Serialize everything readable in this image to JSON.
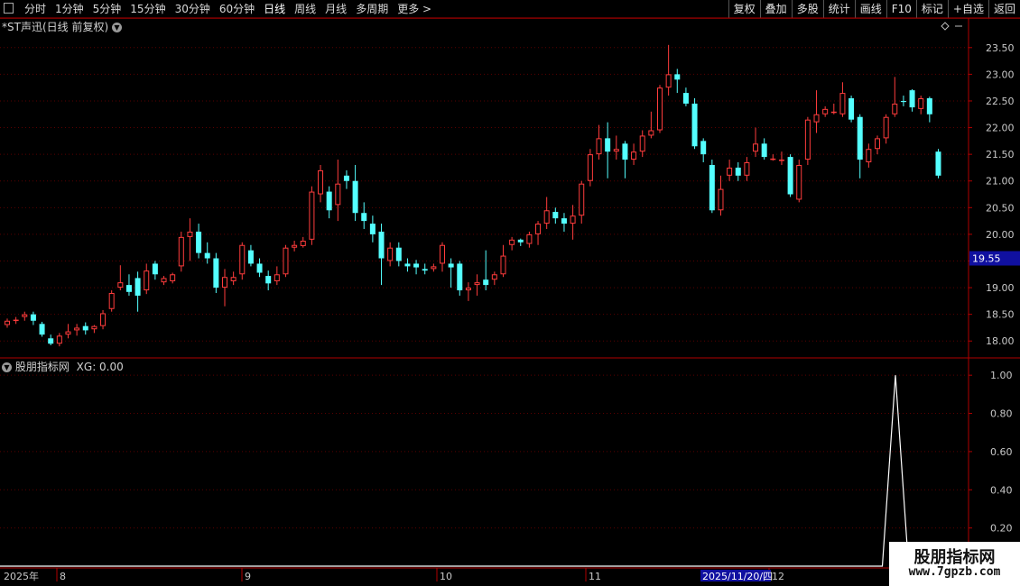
{
  "toolbar": {
    "periods": [
      "分时",
      "1分钟",
      "5分钟",
      "15分钟",
      "30分钟",
      "60分钟",
      "日线",
      "周线",
      "月线",
      "多周期",
      "更多 >"
    ],
    "active_period": "日线",
    "tools": [
      "复权",
      "叠加",
      "多股",
      "统计",
      "画线",
      "F10",
      "标记",
      "+自选",
      "返回"
    ]
  },
  "main_panel": {
    "title": "*ST声迅(日线 前复权)",
    "current_price_tag": "19.55"
  },
  "indicator_panel": {
    "title": "股朋指标网",
    "value_label": "XG: 0.00"
  },
  "x_axis": {
    "year_label": "2025年",
    "month_labels": [
      "8",
      "9",
      "10",
      "11",
      "12"
    ],
    "cursor_date": "2025/11/20/四"
  },
  "logo": {
    "name": "股朋指标网",
    "url": "www.7gpzb.com"
  },
  "colors": {
    "up": "#ff3c3c",
    "down": "#54ffff",
    "grid": "#5a0000",
    "axis": "#b00000",
    "tag_bg": "#1010a0"
  },
  "chart_data": [
    {
      "type": "candlestick",
      "title": "*ST声迅(日线 前复权)",
      "ylim": [
        17.7,
        23.75
      ],
      "y_ticks": [
        18.0,
        18.5,
        19.0,
        19.5,
        20.0,
        20.5,
        21.0,
        21.5,
        22.0,
        22.5,
        23.0,
        23.5
      ],
      "candles": [
        [
          18.3,
          18.38,
          18.25,
          18.42
        ],
        [
          18.38,
          18.4,
          18.32,
          18.45
        ],
        [
          18.45,
          18.5,
          18.38,
          18.55
        ],
        [
          18.5,
          18.38,
          18.3,
          18.55
        ],
        [
          18.32,
          18.12,
          18.08,
          18.36
        ],
        [
          18.05,
          17.95,
          17.92,
          18.12
        ],
        [
          17.95,
          18.1,
          17.9,
          18.15
        ],
        [
          18.12,
          18.18,
          18.05,
          18.32
        ],
        [
          18.2,
          18.25,
          18.1,
          18.32
        ],
        [
          18.28,
          18.2,
          18.12,
          18.35
        ],
        [
          18.22,
          18.28,
          18.15,
          18.3
        ],
        [
          18.28,
          18.52,
          18.22,
          18.58
        ],
        [
          18.6,
          18.9,
          18.55,
          18.95
        ],
        [
          19.0,
          19.1,
          18.95,
          19.42
        ],
        [
          19.05,
          18.92,
          18.85,
          19.25
        ],
        [
          19.18,
          18.85,
          18.55,
          19.3
        ],
        [
          18.95,
          19.32,
          18.88,
          19.45
        ],
        [
          19.45,
          19.25,
          19.15,
          19.5
        ],
        [
          19.1,
          19.18,
          19.05,
          19.22
        ],
        [
          19.12,
          19.25,
          19.08,
          19.28
        ],
        [
          19.4,
          19.95,
          19.3,
          20.05
        ],
        [
          19.95,
          20.05,
          19.5,
          20.3
        ],
        [
          20.05,
          19.65,
          19.55,
          20.2
        ],
        [
          19.65,
          19.55,
          19.45,
          19.85
        ],
        [
          19.55,
          19.0,
          18.9,
          19.65
        ],
        [
          19.0,
          19.2,
          18.65,
          19.35
        ],
        [
          19.12,
          19.2,
          19.05,
          19.3
        ],
        [
          19.25,
          19.8,
          19.15,
          19.85
        ],
        [
          19.7,
          19.45,
          19.4,
          19.8
        ],
        [
          19.45,
          19.28,
          19.2,
          19.55
        ],
        [
          19.22,
          19.08,
          18.95,
          19.32
        ],
        [
          19.12,
          19.25,
          19.05,
          19.4
        ],
        [
          19.25,
          19.75,
          19.2,
          19.8
        ],
        [
          19.75,
          19.8,
          19.68,
          19.88
        ],
        [
          19.78,
          19.88,
          19.75,
          19.95
        ],
        [
          19.9,
          20.8,
          19.8,
          20.9
        ],
        [
          20.75,
          21.2,
          20.6,
          21.3
        ],
        [
          20.8,
          20.45,
          20.3,
          20.9
        ],
        [
          20.55,
          20.95,
          20.25,
          21.4
        ],
        [
          21.1,
          21.0,
          20.85,
          21.2
        ],
        [
          21.0,
          20.4,
          20.25,
          21.3
        ],
        [
          20.4,
          20.25,
          20.1,
          20.6
        ],
        [
          20.2,
          20.0,
          19.85,
          20.35
        ],
        [
          20.05,
          19.55,
          19.05,
          20.2
        ],
        [
          19.5,
          19.75,
          19.4,
          19.85
        ],
        [
          19.75,
          19.5,
          19.4,
          19.85
        ],
        [
          19.45,
          19.4,
          19.3,
          19.55
        ],
        [
          19.45,
          19.38,
          19.25,
          19.52
        ],
        [
          19.35,
          19.32,
          19.25,
          19.45
        ],
        [
          19.35,
          19.4,
          19.3,
          19.45
        ],
        [
          19.45,
          19.8,
          19.3,
          19.85
        ],
        [
          19.45,
          19.38,
          19.0,
          19.55
        ],
        [
          19.45,
          18.95,
          18.85,
          19.5
        ],
        [
          18.95,
          19.0,
          18.75,
          19.1
        ],
        [
          19.05,
          19.1,
          18.85,
          19.25
        ],
        [
          19.15,
          19.05,
          18.95,
          19.7
        ],
        [
          19.15,
          19.25,
          19.05,
          19.3
        ],
        [
          19.25,
          19.6,
          19.2,
          19.8
        ],
        [
          19.8,
          19.9,
          19.7,
          19.95
        ],
        [
          19.9,
          19.85,
          19.78,
          19.92
        ],
        [
          19.82,
          20.0,
          19.75,
          20.05
        ],
        [
          20.0,
          20.2,
          19.8,
          20.25
        ],
        [
          20.2,
          20.45,
          20.1,
          20.7
        ],
        [
          20.42,
          20.3,
          20.2,
          20.5
        ],
        [
          20.3,
          20.2,
          20.05,
          20.4
        ],
        [
          20.2,
          20.35,
          19.9,
          20.55
        ],
        [
          20.35,
          20.95,
          20.2,
          21.0
        ],
        [
          21.0,
          21.5,
          20.9,
          21.6
        ],
        [
          21.5,
          21.8,
          21.4,
          22.05
        ],
        [
          21.8,
          21.55,
          21.05,
          22.1
        ],
        [
          21.55,
          21.6,
          21.4,
          21.85
        ],
        [
          21.7,
          21.4,
          21.05,
          21.75
        ],
        [
          21.4,
          21.55,
          21.3,
          21.7
        ],
        [
          21.55,
          21.85,
          21.45,
          21.95
        ],
        [
          21.85,
          21.95,
          21.8,
          22.3
        ],
        [
          21.95,
          22.75,
          21.9,
          22.8
        ],
        [
          22.75,
          23.0,
          22.6,
          23.55
        ],
        [
          23.0,
          22.9,
          22.65,
          23.1
        ],
        [
          22.65,
          22.45,
          22.4,
          22.75
        ],
        [
          22.45,
          21.65,
          21.6,
          22.55
        ],
        [
          21.75,
          21.5,
          21.35,
          21.8
        ],
        [
          21.3,
          20.45,
          20.4,
          21.4
        ],
        [
          20.45,
          20.85,
          20.35,
          21.1
        ],
        [
          21.1,
          21.25,
          21.0,
          21.4
        ],
        [
          21.25,
          21.1,
          21.0,
          21.35
        ],
        [
          21.1,
          21.35,
          21.0,
          21.45
        ],
        [
          21.55,
          21.7,
          21.45,
          22.0
        ],
        [
          21.7,
          21.45,
          21.4,
          21.8
        ],
        [
          21.42,
          21.42,
          21.38,
          21.5
        ],
        [
          21.4,
          21.4,
          21.3,
          21.55
        ],
        [
          21.45,
          20.75,
          20.7,
          21.5
        ],
        [
          20.65,
          21.3,
          20.6,
          21.4
        ],
        [
          21.4,
          22.15,
          21.3,
          22.2
        ],
        [
          22.1,
          22.25,
          21.9,
          22.7
        ],
        [
          22.25,
          22.35,
          22.2,
          22.4
        ],
        [
          22.3,
          22.3,
          22.25,
          22.45
        ],
        [
          22.25,
          22.65,
          22.2,
          22.85
        ],
        [
          22.55,
          22.15,
          22.1,
          22.6
        ],
        [
          22.2,
          21.4,
          21.05,
          22.25
        ],
        [
          21.35,
          21.6,
          21.25,
          21.7
        ],
        [
          21.6,
          21.8,
          21.5,
          21.85
        ],
        [
          21.8,
          22.2,
          21.7,
          22.25
        ],
        [
          22.25,
          22.45,
          22.2,
          22.95
        ],
        [
          22.5,
          22.48,
          22.4,
          22.6
        ],
        [
          22.7,
          22.38,
          22.3,
          22.72
        ],
        [
          22.35,
          22.55,
          22.25,
          22.6
        ],
        [
          22.55,
          22.25,
          22.1,
          22.58
        ],
        [
          21.55,
          21.1,
          21.05,
          21.6
        ]
      ]
    },
    {
      "type": "line",
      "title": "股朋指标网",
      "series": [
        {
          "name": "XG",
          "values": [
            0,
            0,
            0,
            0,
            0,
            0,
            1,
            0,
            0,
            0,
            0
          ]
        }
      ],
      "ylim": [
        0.0,
        1.1
      ],
      "y_ticks": [
        0.2,
        0.4,
        0.6,
        0.8,
        1.0
      ]
    }
  ]
}
